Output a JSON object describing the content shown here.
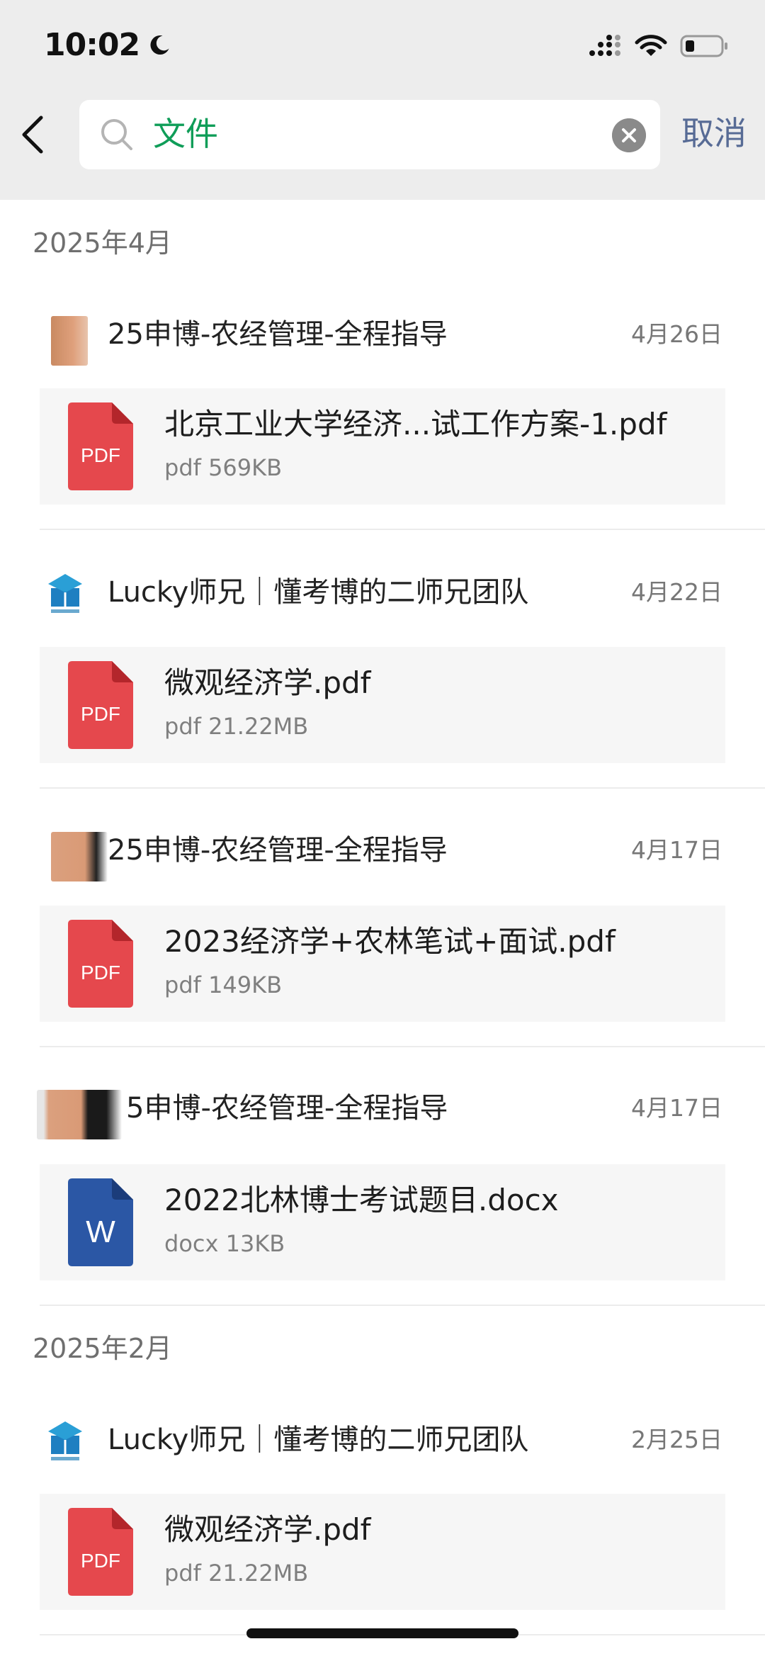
{
  "status_bar": {
    "time": "10:02"
  },
  "search": {
    "query": "文件",
    "cancel_label": "取消"
  },
  "colors": {
    "accent_green": "#0f9d58",
    "link_blue": "#576b95",
    "pdf_red": "#e5484d",
    "word_blue": "#2b57a5"
  },
  "sections": [
    {
      "date": "2025年4月",
      "items": [
        {
          "sender": "25申博-农经管理-全程指导",
          "date": "4月26日",
          "avatar": "blurred-photo",
          "file": {
            "type": "pdf",
            "icon_label": "PDF",
            "name": "北京工业大学经济...试工作方案-1.pdf",
            "meta": "pdf 569KB"
          }
        },
        {
          "sender": "Lucky师兄｜懂考博的二师兄团队",
          "date": "4月22日",
          "avatar": "logo",
          "file": {
            "type": "pdf",
            "icon_label": "PDF",
            "name": "微观经济学.pdf",
            "meta": "pdf 21.22MB"
          }
        },
        {
          "sender": "25申博-农经管理-全程指导",
          "date": "4月17日",
          "avatar": "blurred-photo",
          "file": {
            "type": "pdf",
            "icon_label": "PDF",
            "name": "2023经济学+农林笔试+面试.pdf",
            "meta": "pdf 149KB"
          }
        },
        {
          "sender": "5申博-农经管理-全程指导",
          "date": "4月17日",
          "avatar": "blurred-photo",
          "file": {
            "type": "docx",
            "icon_label": "W",
            "name": "2022北林博士考试题目.docx",
            "meta": "docx 13KB"
          }
        }
      ]
    },
    {
      "date": "2025年2月",
      "items": [
        {
          "sender": "Lucky师兄｜懂考博的二师兄团队",
          "date": "2月25日",
          "avatar": "logo",
          "file": {
            "type": "pdf",
            "icon_label": "PDF",
            "name": "微观经济学.pdf",
            "meta": "pdf 21.22MB"
          }
        }
      ]
    }
  ]
}
